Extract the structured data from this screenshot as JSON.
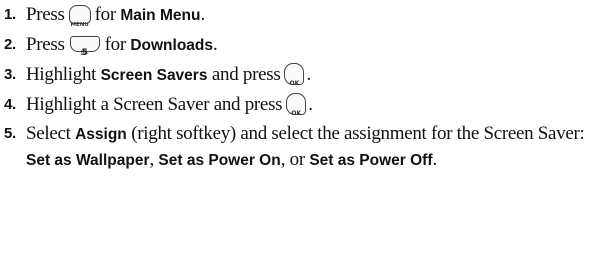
{
  "steps": [
    {
      "number": "1.",
      "text_press": "Press",
      "key_label": "MENU",
      "text_for": "for",
      "target": "Main Menu",
      "end": "."
    },
    {
      "number": "2.",
      "text_press": "Press",
      "key_digit": "5",
      "key_letters": "JKL",
      "text_for": "for",
      "target": "Downloads",
      "end": "."
    },
    {
      "number": "3.",
      "text_highlight": "Highlight",
      "target": "Screen Savers",
      "text_press": "and press",
      "key_label": "OK",
      "end": "."
    },
    {
      "number": "4.",
      "text": "Highlight a Screen Saver and press",
      "key_label": "OK",
      "end": "."
    },
    {
      "number": "5.",
      "text_select": "Select",
      "assign": "Assign",
      "text_mid": "(right softkey) and select the assignment for the Screen Saver:",
      "opt1": "Set as Wallpaper",
      "sep1": ",",
      "opt2": "Set as Power On",
      "sep2": ", or",
      "opt3": "Set as Power Off",
      "end": "."
    }
  ],
  "icons": {
    "menu_key": "menu-key-icon",
    "key_5": "five-key-icon",
    "ok_key": "ok-key-icon"
  }
}
